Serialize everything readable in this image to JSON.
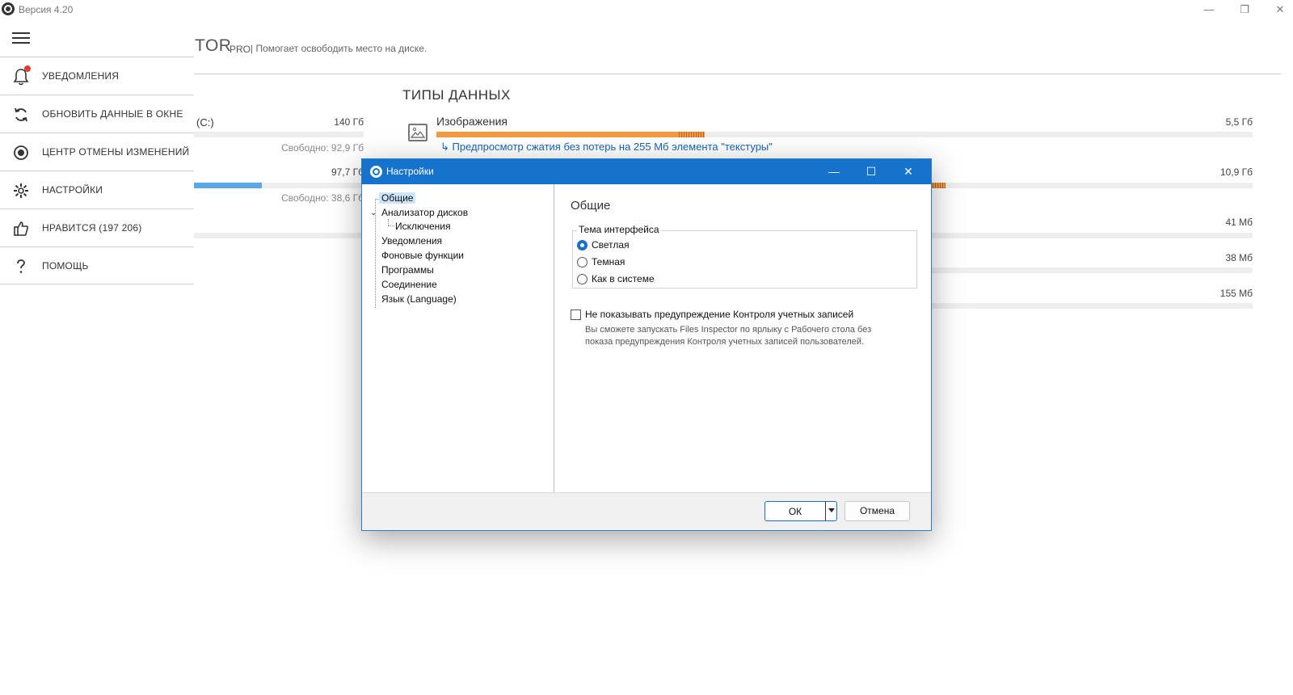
{
  "window": {
    "version": "Версия 4.20",
    "minimize": "—",
    "restore": "❐",
    "close": "✕"
  },
  "header": {
    "brand": "TOR",
    "brand_suffix": "PRO",
    "subtitle": "| Помогает освободить место на диске."
  },
  "sidebar": {
    "items": [
      {
        "label": "УВЕДОМЛЕНИЯ",
        "icon": "bell-icon"
      },
      {
        "label": "ОБНОВИТЬ ДАННЫЕ В ОКНЕ",
        "icon": "refresh-icon"
      },
      {
        "label": "ЦЕНТР ОТМЕНЫ ИЗМЕНЕНИЙ",
        "icon": "undo-center-icon"
      },
      {
        "label": "НАСТРОЙКИ",
        "icon": "gear-icon"
      },
      {
        "label": "НРАВИТСЯ (197 206)",
        "icon": "thumbs-up-icon"
      },
      {
        "label": "ПОМОЩЬ",
        "icon": "question-icon"
      }
    ]
  },
  "disks": [
    {
      "label": "(C:)",
      "size": "140 Гб",
      "free": "Свободно: 92,9 Гб",
      "used_fraction": 0.0
    },
    {
      "label": "",
      "size": "97,7 Гб",
      "free": "Свободно: 38,6 Гб",
      "used_fraction": 0.4
    }
  ],
  "data_types": {
    "title": "ТИПЫ ДАННЫХ",
    "items": [
      {
        "name": "Изображения",
        "size": "5,5 Гб",
        "hint": "↳ Предпросмотр сжатия без потерь на 255 Мб элемента \"текстуры\""
      },
      {
        "name": "",
        "size": "10,9 Гб"
      },
      {
        "name": "",
        "size": "41 Мб"
      },
      {
        "name": "",
        "size": "38 Мб"
      },
      {
        "name": "",
        "size": "155 Мб"
      }
    ]
  },
  "dialog": {
    "title": "Настройки",
    "tree": [
      {
        "label": "Общие",
        "selected": true
      },
      {
        "label": "Анализатор дисков",
        "expanded": true
      },
      {
        "label": "Исключения"
      },
      {
        "label": "Уведомления"
      },
      {
        "label": "Фоновые функции"
      },
      {
        "label": "Программы"
      },
      {
        "label": "Соединение"
      },
      {
        "label": "Язык (Language)"
      }
    ],
    "panel_title": "Общие",
    "theme_group": "Тема интерфейса",
    "theme_options": [
      {
        "label": "Светлая",
        "checked": true
      },
      {
        "label": "Темная",
        "checked": false
      },
      {
        "label": "Как в системе",
        "checked": false
      }
    ],
    "uac_checkbox": "Не показывать предупреждение Контроля учетных записей",
    "uac_checked": false,
    "uac_description": "Вы сможете запускать Files Inspector по ярлыку с Рабочего стола без показа предупреждения Контроля учетных записей пользователей.",
    "ok": "ОК",
    "cancel": "Отмена"
  },
  "colors": {
    "accent": "#1673cc",
    "bar_orange": "#f29a3f",
    "bar_blue": "#5aa9e6",
    "notification_dot": "#e53935"
  }
}
